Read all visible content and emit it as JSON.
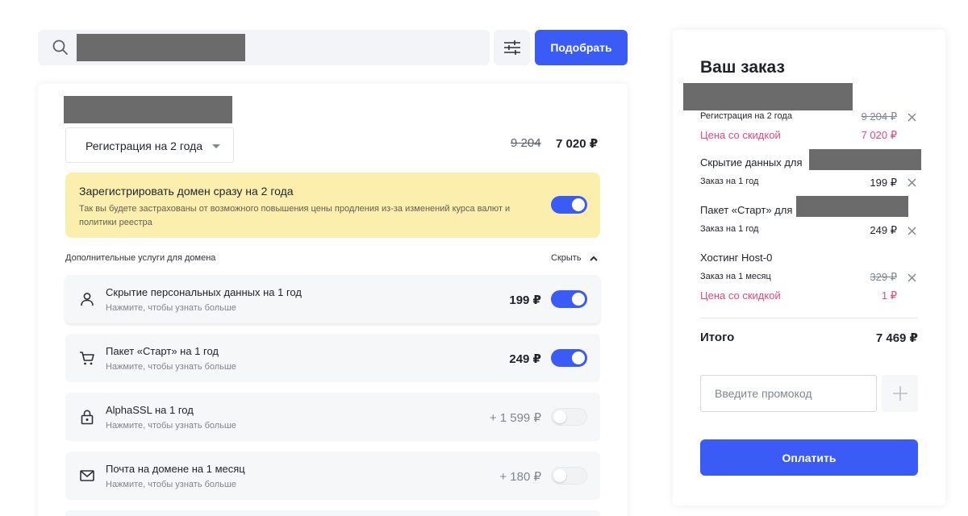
{
  "search": {
    "button_label": "Подобрать"
  },
  "domain": {
    "period_select": "Регистрация на 2 года",
    "old_price": "9 204",
    "new_price": "7 020 ₽"
  },
  "promo_banner": {
    "title": "Зарегистрировать домен сразу на 2 года",
    "description": "Так вы будете застрахованы от возможного повышения цены продления из-за изменений курса валют и политики реестра",
    "enabled": true
  },
  "services_section": {
    "label": "Дополнительные услуги для домена",
    "toggle_label": "Скрыть",
    "items": [
      {
        "title": "Скрытие персональных данных на 1 год",
        "subtitle": "Нажмите, чтобы узнать больше",
        "price": "199 ₽",
        "enabled": true,
        "icon": "person-icon"
      },
      {
        "title": "Пакет «Старт» на 1 год",
        "subtitle": "Нажмите, чтобы узнать больше",
        "price": "249 ₽",
        "enabled": true,
        "icon": "cart-icon"
      },
      {
        "title": "AlphaSSL на 1 год",
        "subtitle": "Нажмите, чтобы узнать больше",
        "price": "+ 1 599 ₽",
        "enabled": false,
        "icon": "lock-icon"
      },
      {
        "title": "Почта на домене на 1 месяц",
        "subtitle": "Нажмите, чтобы узнать больше",
        "price": "+ 180 ₽",
        "enabled": false,
        "icon": "mail-icon"
      }
    ]
  },
  "order": {
    "title": "Ваш заказ",
    "items": [
      {
        "name": "",
        "line": "Регистрация на 2 года",
        "old_price": "9 204 ₽",
        "discount_label": "Цена со скидкой",
        "price": "7 020 ₽"
      },
      {
        "name": "Скрытие данных для",
        "line": "Заказ на 1 год",
        "price": "199 ₽"
      },
      {
        "name": "Пакет «Старт» для",
        "line": "Заказ на 1 год",
        "price": "249 ₽"
      },
      {
        "name": "Хостинг Host-0",
        "line": "Заказ на 1 месяц",
        "old_price": "329 ₽",
        "discount_label": "Цена со скидкой",
        "price": "1 ₽"
      }
    ],
    "total_label": "Итого",
    "total_value": "7 469 ₽",
    "promo_placeholder": "Введите промокод",
    "pay_label": "Оплатить"
  },
  "colors": {
    "accent": "#3b5bf7",
    "discount": "#e8467c",
    "banner": "#fcefad",
    "redacted": "#6b6b6b"
  }
}
